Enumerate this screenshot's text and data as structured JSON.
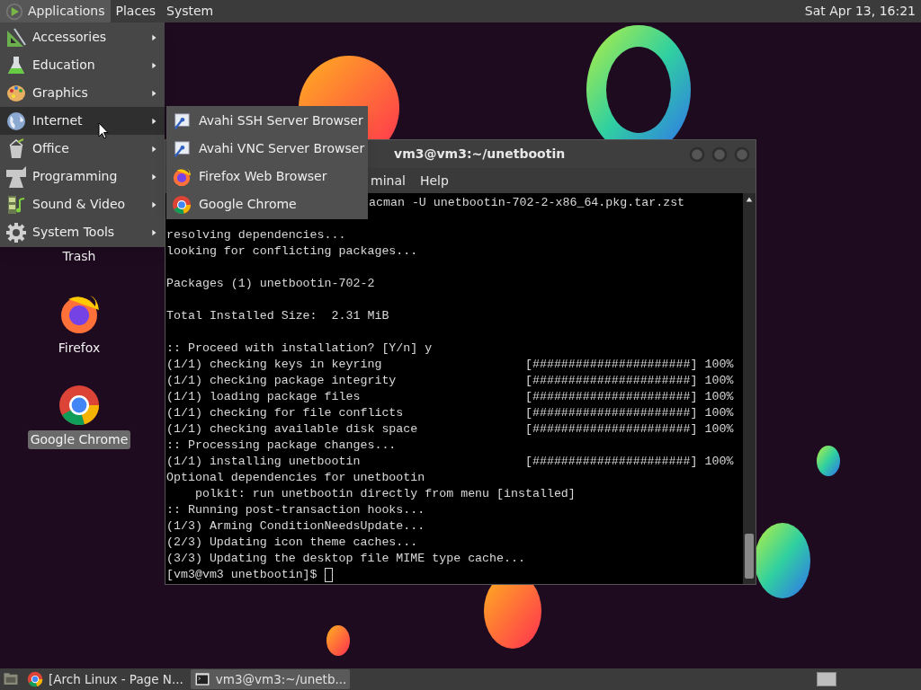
{
  "top_panel": {
    "menus": [
      {
        "label": "Applications",
        "selected": true
      },
      {
        "label": "Places",
        "selected": false
      },
      {
        "label": "System",
        "selected": false
      }
    ],
    "clock": "Sat Apr 13, 16:21"
  },
  "app_menu": {
    "items": [
      {
        "label": "Accessories",
        "selected": false
      },
      {
        "label": "Education",
        "selected": false
      },
      {
        "label": "Graphics",
        "selected": false
      },
      {
        "label": "Internet",
        "selected": true
      },
      {
        "label": "Office",
        "selected": false
      },
      {
        "label": "Programming",
        "selected": false
      },
      {
        "label": "Sound & Video",
        "selected": false
      },
      {
        "label": "System Tools",
        "selected": false
      }
    ]
  },
  "submenu": {
    "items": [
      {
        "label": "Avahi SSH Server Browser",
        "selected": false
      },
      {
        "label": "Avahi VNC Server Browser",
        "selected": false
      },
      {
        "label": "Firefox Web Browser",
        "selected": false
      },
      {
        "label": "Google Chrome",
        "selected": false
      }
    ]
  },
  "desktop_icons": [
    {
      "label": "Trash",
      "selected": false
    },
    {
      "label": "Firefox",
      "selected": false
    },
    {
      "label": "Google Chrome",
      "selected": true
    }
  ],
  "terminal": {
    "title": "vm3@vm3:~/unetbootin",
    "menus": [
      "minal",
      "Help"
    ],
    "first_line": "acman -U unetbootin-702-2-x86_64.pkg.tar.zst",
    "blocks": [
      [
        "resolving dependencies...",
        "looking for conflicting packages..."
      ],
      [
        "Packages (1) unetbootin-702-2"
      ],
      [
        "Total Installed Size:  2.31 MiB"
      ],
      [
        ":: Proceed with installation? [Y/n] y",
        "(1/1) checking keys in keyring                    [######################] 100%",
        "(1/1) checking package integrity                  [######################] 100%",
        "(1/1) loading package files                       [######################] 100%",
        "(1/1) checking for file conflicts                 [######################] 100%",
        "(1/1) checking available disk space               [######################] 100%",
        ":: Processing package changes...",
        "(1/1) installing unetbootin                       [######################] 100%",
        "Optional dependencies for unetbootin",
        "    polkit: run unetbootin directly from menu [installed]",
        ":: Running post-transaction hooks...",
        "(1/3) Arming ConditionNeedsUpdate...",
        "(2/3) Updating icon theme caches...",
        "(3/3) Updating the desktop file MIME type cache...",
        "[vm3@vm3 unetbootin]$ "
      ]
    ]
  },
  "taskbar": {
    "tasks": [
      {
        "label": "[Arch Linux - Page N...",
        "selected": false
      },
      {
        "label": "vm3@vm3:~/unetb...",
        "selected": true
      }
    ]
  }
}
